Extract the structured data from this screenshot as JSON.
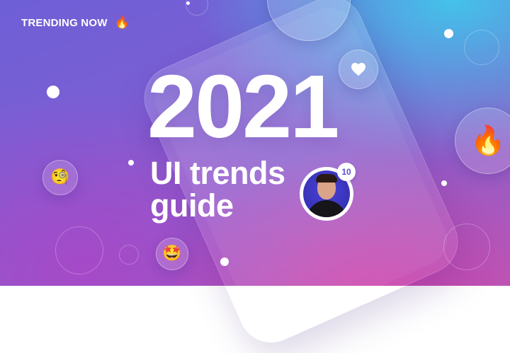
{
  "header": {
    "label": "TRENDING NOW",
    "fire": "🔥"
  },
  "hero": {
    "year": "2021",
    "line1": "UI trends",
    "line2": "guide"
  },
  "notification": {
    "count": "10"
  },
  "floaters": {
    "fire": "🔥",
    "face_left": "🧐",
    "face_bottom": "🤩"
  },
  "colors": {
    "accent": "#6e5fd6",
    "secondary": "#d640aa",
    "cyan": "#40c8eb",
    "text": "#ffffff"
  }
}
